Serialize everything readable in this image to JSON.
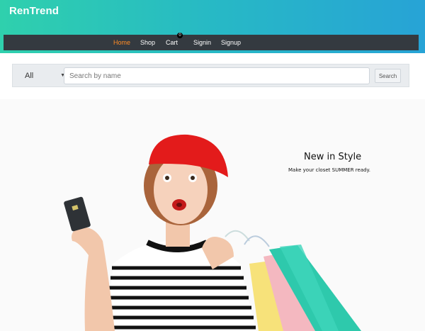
{
  "brand": {
    "name": "RenTrend"
  },
  "nav": {
    "items": [
      {
        "label": "Home",
        "active": true
      },
      {
        "label": "Shop",
        "active": false
      },
      {
        "label": "Cart",
        "active": false
      },
      {
        "label": "Signin",
        "active": false
      },
      {
        "label": "Signup",
        "active": false
      }
    ],
    "cart_count": "0"
  },
  "search": {
    "category_selected": "All",
    "placeholder": "Search by name",
    "value": "",
    "button_label": "Search"
  },
  "hero": {
    "title": "New in Style",
    "subtitle": "Make your closet SUMMER ready."
  },
  "colors": {
    "header_start": "#2fd0ad",
    "header_end": "#27a3d6",
    "navbar_bg": "#343a40",
    "nav_active": "#ff8c26"
  }
}
